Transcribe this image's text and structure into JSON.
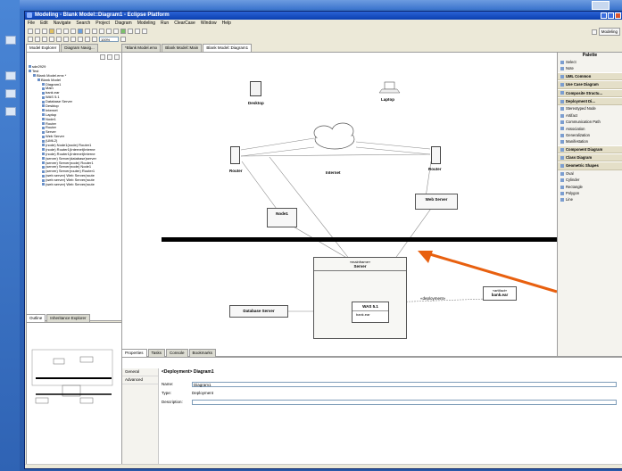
{
  "window": {
    "title": "Modeling - Blank Model::Diagram1 - Eclipse Platform",
    "menus": [
      "File",
      "Edit",
      "Navigate",
      "Search",
      "Project",
      "Diagram",
      "Modeling",
      "Run",
      "ClearCase",
      "Window",
      "Help"
    ],
    "zoom": "100%",
    "perspective_label": "Modeling"
  },
  "left_tabs": [
    "Model Explorer",
    "Diagram Navig..."
  ],
  "editor_tabs": [
    "*Blank Model.emx",
    "Blank Model::Main",
    "Blank Model::Diagram1"
  ],
  "tree": [
    {
      "text": "sde2929",
      "indent": 0
    },
    {
      "text": "Test",
      "indent": 0
    },
    {
      "text": "Blank Model.emx *",
      "indent": 1
    },
    {
      "text": "Blank Model",
      "indent": 2
    },
    {
      "text": "Diagram1",
      "indent": 3
    },
    {
      "text": "Main",
      "indent": 3
    },
    {
      "text": "bank.ear",
      "indent": 3
    },
    {
      "text": "WAS 5.1",
      "indent": 3
    },
    {
      "text": "Database Server",
      "indent": 3
    },
    {
      "text": "Desktop",
      "indent": 3
    },
    {
      "text": "Internet",
      "indent": 3
    },
    {
      "text": "Laptop",
      "indent": 3
    },
    {
      "text": "Node1",
      "indent": 3
    },
    {
      "text": "Router",
      "indent": 3
    },
    {
      "text": "Router",
      "indent": 3
    },
    {
      "text": "Server",
      "indent": 3
    },
    {
      "text": "Web Server",
      "indent": 3
    },
    {
      "text": "(UML2)",
      "indent": 3
    },
    {
      "text": "(node) Node1(node) Router1",
      "indent": 3
    },
    {
      "text": "(node) Router1(Internet)Interne",
      "indent": 3
    },
    {
      "text": "(node) Router1(Internet)Interne",
      "indent": 3
    },
    {
      "text": "(server) Server(database)server",
      "indent": 3
    },
    {
      "text": "(server) Server(node) Router1",
      "indent": 3
    },
    {
      "text": "(server) Server(node) Node1",
      "indent": 3
    },
    {
      "text": "(server) Server(router) Router1",
      "indent": 3
    },
    {
      "text": "(web server) Web Server(route",
      "indent": 3
    },
    {
      "text": "(web server) Web Server(route",
      "indent": 3
    },
    {
      "text": "(web server) Web Server(route",
      "indent": 3
    }
  ],
  "outline_tabs": [
    "Outline",
    "Inheritance Explorer"
  ],
  "palette": {
    "title": "Palette",
    "items": [
      {
        "label": "Select",
        "drawer": false
      },
      {
        "label": "Note",
        "drawer": false
      },
      {
        "label": "UML Common",
        "drawer": true
      },
      {
        "label": "Use Case Diagram",
        "drawer": true
      },
      {
        "label": "Composite Structu...",
        "drawer": true
      },
      {
        "label": "Deployment Di...",
        "drawer": true
      },
      {
        "label": "Stereotyped Node",
        "drawer": false
      },
      {
        "label": "Artifact",
        "drawer": false
      },
      {
        "label": "Communication Path",
        "drawer": false
      },
      {
        "label": "Association",
        "drawer": false
      },
      {
        "label": "Generalization",
        "drawer": false
      },
      {
        "label": "Manifestation",
        "drawer": false
      },
      {
        "label": "Component Diagram",
        "drawer": true
      },
      {
        "label": "Class Diagram",
        "drawer": true
      },
      {
        "label": "Geometric Shapes",
        "drawer": true
      },
      {
        "label": "Oval",
        "drawer": false
      },
      {
        "label": "Cylinder",
        "drawer": false
      },
      {
        "label": "Rectangle",
        "drawer": false
      },
      {
        "label": "Polygon",
        "drawer": false
      },
      {
        "label": "Line",
        "drawer": false
      }
    ]
  },
  "diagram": {
    "desktop": "Desktop",
    "laptop": "Laptop",
    "router_left": "Router",
    "router_right": "Router",
    "internet": "Internet",
    "node1": "Node1",
    "web_server": "Web Server",
    "server_stereotype": "«mainframe»",
    "server": "Server",
    "database_server": "Database Server",
    "was": "WAS 5.1",
    "bank_ear": "bank.ear",
    "deployment": "«deployment»",
    "artifact_stereotype": "«artifact»",
    "artifact": "bank.ear"
  },
  "annotation": {
    "arrow_color": "#e8600f",
    "bar_color": "#000000"
  },
  "props": {
    "tabs": [
      "Properties",
      "Tasks",
      "Console",
      "Bookmarks"
    ],
    "side": [
      "General",
      "Advanced"
    ],
    "header": "<Deployment> Diagram1",
    "name_label": "Name:",
    "name_value": "Diagram1",
    "type_label": "Type:",
    "type_value": "Deployment",
    "desc_label": "Description:"
  }
}
